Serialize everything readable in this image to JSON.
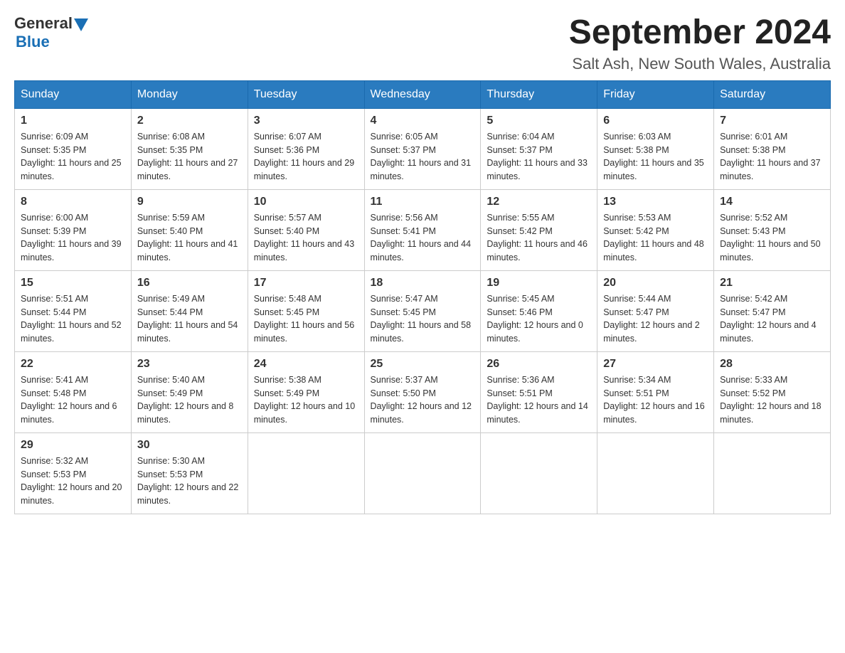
{
  "header": {
    "logo_general": "General",
    "logo_blue": "Blue",
    "month_title": "September 2024",
    "location": "Salt Ash, New South Wales, Australia"
  },
  "columns": [
    "Sunday",
    "Monday",
    "Tuesday",
    "Wednesday",
    "Thursday",
    "Friday",
    "Saturday"
  ],
  "weeks": [
    [
      {
        "day": "1",
        "sunrise": "6:09 AM",
        "sunset": "5:35 PM",
        "daylight": "11 hours and 25 minutes."
      },
      {
        "day": "2",
        "sunrise": "6:08 AM",
        "sunset": "5:35 PM",
        "daylight": "11 hours and 27 minutes."
      },
      {
        "day": "3",
        "sunrise": "6:07 AM",
        "sunset": "5:36 PM",
        "daylight": "11 hours and 29 minutes."
      },
      {
        "day": "4",
        "sunrise": "6:05 AM",
        "sunset": "5:37 PM",
        "daylight": "11 hours and 31 minutes."
      },
      {
        "day": "5",
        "sunrise": "6:04 AM",
        "sunset": "5:37 PM",
        "daylight": "11 hours and 33 minutes."
      },
      {
        "day": "6",
        "sunrise": "6:03 AM",
        "sunset": "5:38 PM",
        "daylight": "11 hours and 35 minutes."
      },
      {
        "day": "7",
        "sunrise": "6:01 AM",
        "sunset": "5:38 PM",
        "daylight": "11 hours and 37 minutes."
      }
    ],
    [
      {
        "day": "8",
        "sunrise": "6:00 AM",
        "sunset": "5:39 PM",
        "daylight": "11 hours and 39 minutes."
      },
      {
        "day": "9",
        "sunrise": "5:59 AM",
        "sunset": "5:40 PM",
        "daylight": "11 hours and 41 minutes."
      },
      {
        "day": "10",
        "sunrise": "5:57 AM",
        "sunset": "5:40 PM",
        "daylight": "11 hours and 43 minutes."
      },
      {
        "day": "11",
        "sunrise": "5:56 AM",
        "sunset": "5:41 PM",
        "daylight": "11 hours and 44 minutes."
      },
      {
        "day": "12",
        "sunrise": "5:55 AM",
        "sunset": "5:42 PM",
        "daylight": "11 hours and 46 minutes."
      },
      {
        "day": "13",
        "sunrise": "5:53 AM",
        "sunset": "5:42 PM",
        "daylight": "11 hours and 48 minutes."
      },
      {
        "day": "14",
        "sunrise": "5:52 AM",
        "sunset": "5:43 PM",
        "daylight": "11 hours and 50 minutes."
      }
    ],
    [
      {
        "day": "15",
        "sunrise": "5:51 AM",
        "sunset": "5:44 PM",
        "daylight": "11 hours and 52 minutes."
      },
      {
        "day": "16",
        "sunrise": "5:49 AM",
        "sunset": "5:44 PM",
        "daylight": "11 hours and 54 minutes."
      },
      {
        "day": "17",
        "sunrise": "5:48 AM",
        "sunset": "5:45 PM",
        "daylight": "11 hours and 56 minutes."
      },
      {
        "day": "18",
        "sunrise": "5:47 AM",
        "sunset": "5:45 PM",
        "daylight": "11 hours and 58 minutes."
      },
      {
        "day": "19",
        "sunrise": "5:45 AM",
        "sunset": "5:46 PM",
        "daylight": "12 hours and 0 minutes."
      },
      {
        "day": "20",
        "sunrise": "5:44 AM",
        "sunset": "5:47 PM",
        "daylight": "12 hours and 2 minutes."
      },
      {
        "day": "21",
        "sunrise": "5:42 AM",
        "sunset": "5:47 PM",
        "daylight": "12 hours and 4 minutes."
      }
    ],
    [
      {
        "day": "22",
        "sunrise": "5:41 AM",
        "sunset": "5:48 PM",
        "daylight": "12 hours and 6 minutes."
      },
      {
        "day": "23",
        "sunrise": "5:40 AM",
        "sunset": "5:49 PM",
        "daylight": "12 hours and 8 minutes."
      },
      {
        "day": "24",
        "sunrise": "5:38 AM",
        "sunset": "5:49 PM",
        "daylight": "12 hours and 10 minutes."
      },
      {
        "day": "25",
        "sunrise": "5:37 AM",
        "sunset": "5:50 PM",
        "daylight": "12 hours and 12 minutes."
      },
      {
        "day": "26",
        "sunrise": "5:36 AM",
        "sunset": "5:51 PM",
        "daylight": "12 hours and 14 minutes."
      },
      {
        "day": "27",
        "sunrise": "5:34 AM",
        "sunset": "5:51 PM",
        "daylight": "12 hours and 16 minutes."
      },
      {
        "day": "28",
        "sunrise": "5:33 AM",
        "sunset": "5:52 PM",
        "daylight": "12 hours and 18 minutes."
      }
    ],
    [
      {
        "day": "29",
        "sunrise": "5:32 AM",
        "sunset": "5:53 PM",
        "daylight": "12 hours and 20 minutes."
      },
      {
        "day": "30",
        "sunrise": "5:30 AM",
        "sunset": "5:53 PM",
        "daylight": "12 hours and 22 minutes."
      },
      null,
      null,
      null,
      null,
      null
    ]
  ]
}
